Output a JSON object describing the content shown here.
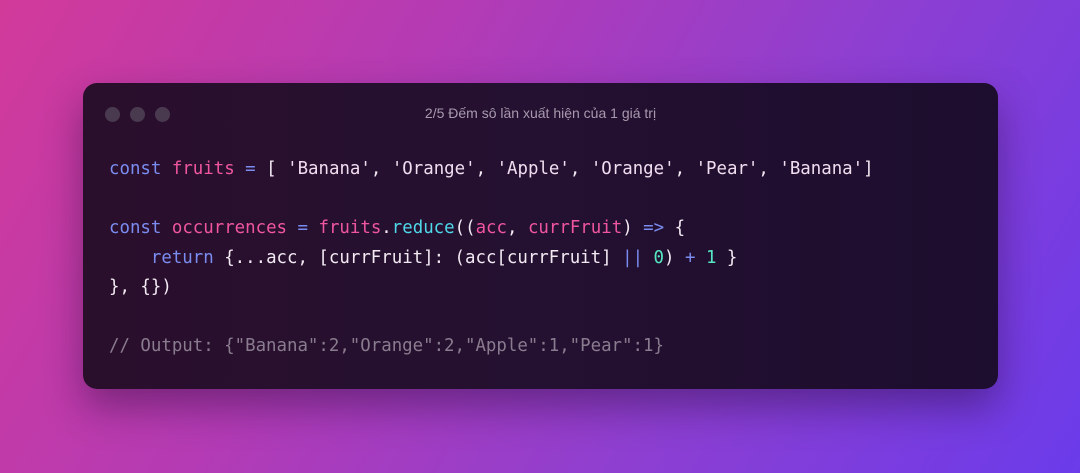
{
  "window": {
    "title": "2/5 Đếm sô lần xuất hiện của 1 giá trị",
    "controls": [
      "dot-1",
      "dot-2",
      "dot-3"
    ]
  },
  "code": {
    "line1": {
      "kw": "const",
      "var": "fruits",
      "eq": "=",
      "open": "[",
      "s1": "'Banana'",
      "c1": ",",
      "s2": "'Orange'",
      "c2": ",",
      "s3": "'Apple'",
      "c3": ",",
      "s4": "'Orange'",
      "c4": ",",
      "s5": "'Pear'",
      "c5": ",",
      "s6": "'Banana'",
      "close": "]"
    },
    "line3": {
      "kw": "const",
      "var": "occurrences",
      "eq": "=",
      "obj": "fruits",
      "dot": ".",
      "fn": "reduce",
      "open": "((",
      "p1": "acc",
      "comma": ",",
      "p2": "currFruit",
      "close": ")",
      "arrow": "=>",
      "brace": "{"
    },
    "line4": {
      "kw": "return",
      "a": "{...acc, [currFruit]: (acc[currFruit]",
      "or": "||",
      "zero": "0",
      "paren": ")",
      "plus": "+",
      "one": "1",
      "end": "}"
    },
    "line5": "}, {})",
    "comment": "// Output: {\"Banana\":2,\"Orange\":2,\"Apple\":1,\"Pear\":1}"
  },
  "colors": {
    "keyword": "#7b8cf0",
    "variable": "#f0569f",
    "function": "#4fd9e8",
    "string": "#f1ddf0",
    "number": "#56e6c2",
    "comment": "#8a7c8f"
  }
}
